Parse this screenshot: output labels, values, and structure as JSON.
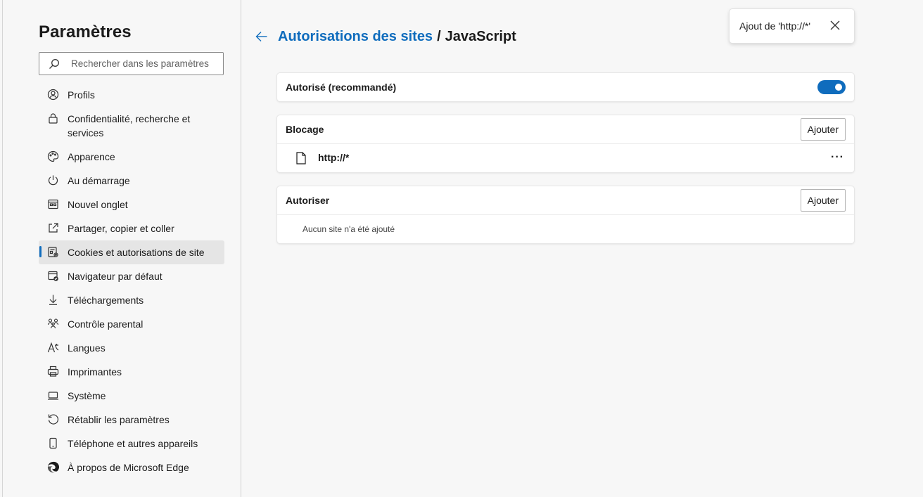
{
  "sidebar": {
    "title": "Paramètres",
    "search_placeholder": "Rechercher dans les paramètres",
    "items": [
      {
        "label": "Profils",
        "icon": "profile-icon"
      },
      {
        "label": "Confidentialité, recherche et services",
        "icon": "lock-icon"
      },
      {
        "label": "Apparence",
        "icon": "palette-icon"
      },
      {
        "label": "Au démarrage",
        "icon": "power-icon"
      },
      {
        "label": "Nouvel onglet",
        "icon": "new-tab-icon"
      },
      {
        "label": "Partager, copier et coller",
        "icon": "share-icon"
      },
      {
        "label": "Cookies et autorisations de site",
        "icon": "cookies-icon",
        "active": true
      },
      {
        "label": "Navigateur par défaut",
        "icon": "default-browser-icon"
      },
      {
        "label": "Téléchargements",
        "icon": "download-icon"
      },
      {
        "label": "Contrôle parental",
        "icon": "family-icon"
      },
      {
        "label": "Langues",
        "icon": "language-icon"
      },
      {
        "label": "Imprimantes",
        "icon": "printer-icon"
      },
      {
        "label": "Système",
        "icon": "laptop-icon"
      },
      {
        "label": "Rétablir les paramètres",
        "icon": "reset-icon"
      },
      {
        "label": "Téléphone et autres appareils",
        "icon": "phone-icon"
      },
      {
        "label": "À propos de Microsoft Edge",
        "icon": "edge-logo-icon"
      }
    ]
  },
  "header": {
    "breadcrumb_link": "Autorisations des sites",
    "separator": "/",
    "current": "JavaScript"
  },
  "allowed_toggle": {
    "label": "Autorisé (recommandé)",
    "on": true,
    "accent": "#0f6cbd"
  },
  "blocked": {
    "title": "Blocage",
    "add_label": "Ajouter",
    "sites": [
      {
        "url": "http://*",
        "more": "···"
      }
    ]
  },
  "allow": {
    "title": "Autoriser",
    "add_label": "Ajouter",
    "empty_text": "Aucun site n'a été ajouté"
  },
  "toast": {
    "message": "Ajout de 'http://*'"
  }
}
